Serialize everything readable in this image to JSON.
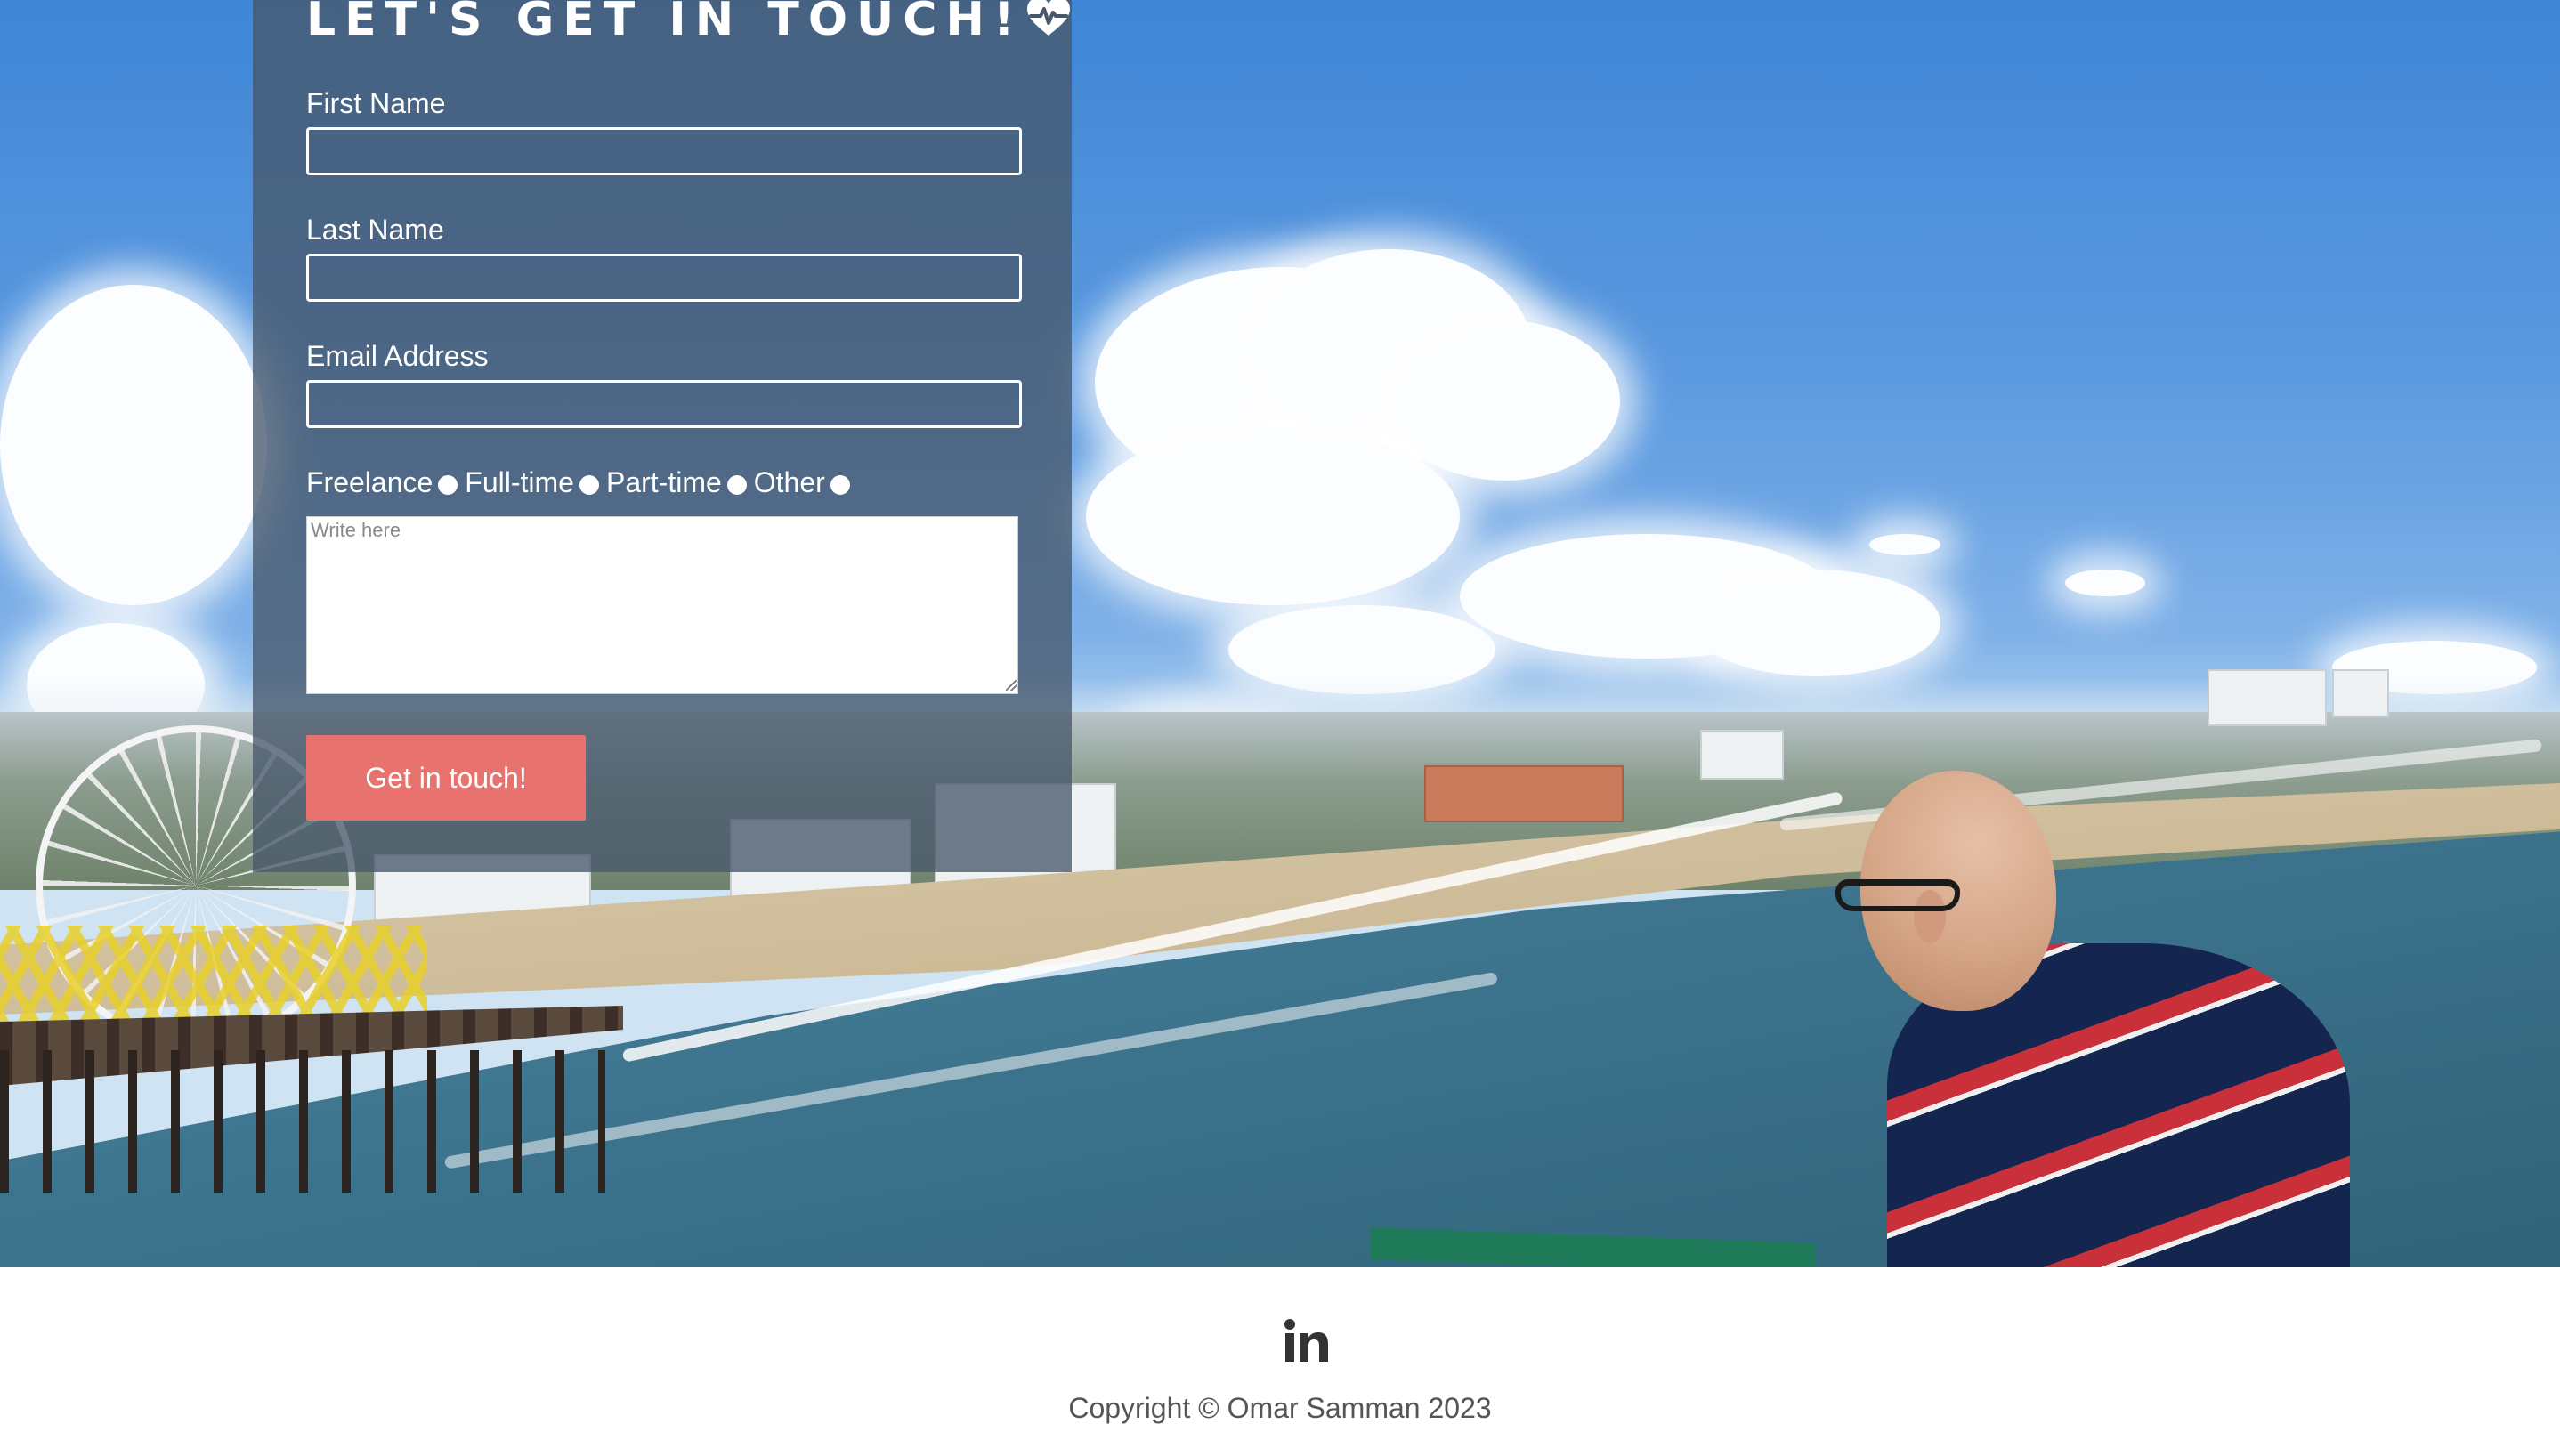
{
  "form": {
    "title": "LET'S GET IN TOUCH!",
    "title_icon": "heart-pulse-icon",
    "first_name_label": "First Name",
    "first_name_value": "",
    "last_name_label": "Last Name",
    "last_name_value": "",
    "email_label": "Email Address",
    "email_value": "",
    "options": [
      "Freelance",
      "Full-time",
      "Part-time",
      "Other"
    ],
    "message_placeholder": "Write here",
    "submit_label": "Get in touch!"
  },
  "footer": {
    "social_icon": "linkedin-icon",
    "copyright": "Copyright © Omar Samman 2023"
  },
  "colors": {
    "panel_overlay": "#48586c",
    "button": "#e8736e",
    "footer_text": "#555555"
  }
}
